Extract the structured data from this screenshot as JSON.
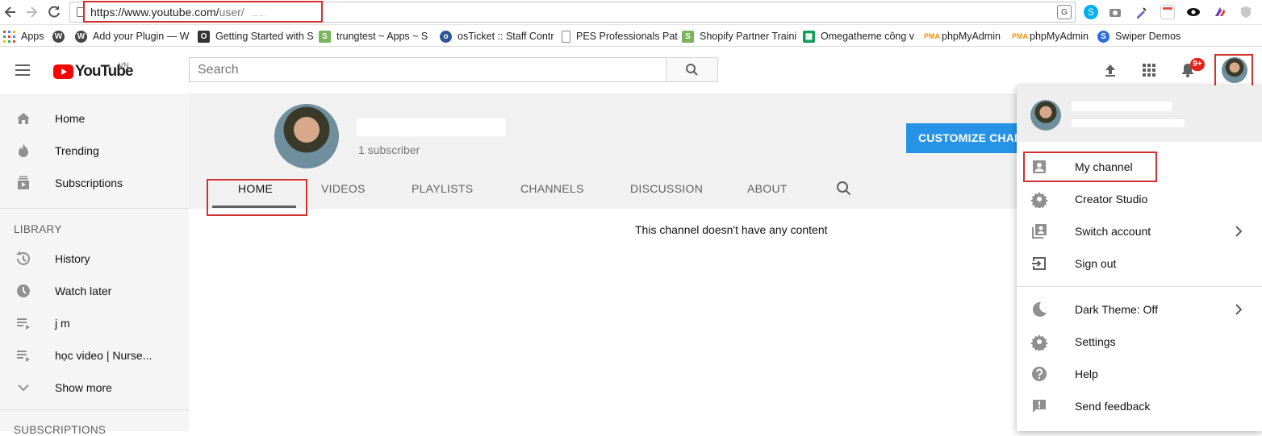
{
  "browser": {
    "url_host": "https://www.youtube.com/",
    "url_path": "user/",
    "url_suffix": "...  ...",
    "bookmarks": [
      {
        "label": "Apps",
        "icon": "apps-grid-icon",
        "color": "#e94235"
      },
      {
        "label": "",
        "icon": "wordpress-icon",
        "color": "#464646"
      },
      {
        "label": "Add your Plugin — W",
        "icon": "wordpress-icon",
        "color": "#464646"
      },
      {
        "label": "Getting Started with S",
        "icon": "o-icon",
        "color": "#333333"
      },
      {
        "label": "trungtest ~ Apps ~ S",
        "icon": "shopify-icon",
        "color": "#7ab55c"
      },
      {
        "label": "osTicket :: Staff Contr",
        "icon": "osticket-icon",
        "color": "#2b5797"
      },
      {
        "label": "PES Professionals Pat",
        "icon": "page-icon",
        "color": "#888888"
      },
      {
        "label": "Shopify Partner Traini",
        "icon": "shopify-icon",
        "color": "#7ab55c"
      },
      {
        "label": "Omegatheme công v",
        "icon": "sheets-icon",
        "color": "#0f9d58"
      },
      {
        "label": "phpMyAdmin",
        "icon": "phpmyadmin-icon",
        "color": "#f29111"
      },
      {
        "label": "phpMyAdmin",
        "icon": "phpmyadmin-icon",
        "color": "#f29111"
      },
      {
        "label": "Swiper Demos",
        "icon": "swiper-icon",
        "color": "#2d6cdf"
      }
    ]
  },
  "header": {
    "logo_text": "YouTube",
    "logo_region": "VN",
    "search_placeholder": "Search",
    "notification_count": "9+"
  },
  "sidebar": {
    "main_items": [
      {
        "label": "Home",
        "icon": "home-icon"
      },
      {
        "label": "Trending",
        "icon": "trending-flame-icon"
      },
      {
        "label": "Subscriptions",
        "icon": "subscriptions-icon"
      }
    ],
    "library_title": "LIBRARY",
    "library_items": [
      {
        "label": "History",
        "icon": "history-icon"
      },
      {
        "label": "Watch later",
        "icon": "clock-icon"
      },
      {
        "label": "j m",
        "icon": "playlist-icon"
      },
      {
        "label": "học video | Nurse...",
        "icon": "playlist-icon"
      },
      {
        "label": "Show more",
        "icon": "chevron-down-icon"
      }
    ],
    "subscriptions_title": "SUBSCRIPTIONS"
  },
  "channel": {
    "subscribers": "1 subscriber",
    "customize_label": "CUSTOMIZE CHANNEL",
    "tabs": [
      "HOME",
      "VIDEOS",
      "PLAYLISTS",
      "CHANNELS",
      "DISCUSSION",
      "ABOUT"
    ],
    "active_tab": "HOME",
    "empty_message": "This channel doesn't have any content"
  },
  "account_menu": {
    "items": [
      {
        "label": "My channel",
        "icon": "person-icon"
      },
      {
        "label": "Creator Studio",
        "icon": "gear-icon"
      },
      {
        "label": "Switch account",
        "icon": "switch-account-icon"
      },
      {
        "label": "Sign out",
        "icon": "sign-out-icon"
      }
    ],
    "items2": [
      {
        "label": "Dark Theme: Off",
        "icon": "moon-icon"
      },
      {
        "label": "Settings",
        "icon": "gear-icon"
      },
      {
        "label": "Help",
        "icon": "help-icon"
      },
      {
        "label": "Send feedback",
        "icon": "feedback-icon"
      }
    ]
  },
  "colors": {
    "accent_blue": "#2793e6",
    "youtube_red": "#ff0000",
    "highlight_red": "#d32f2f"
  }
}
